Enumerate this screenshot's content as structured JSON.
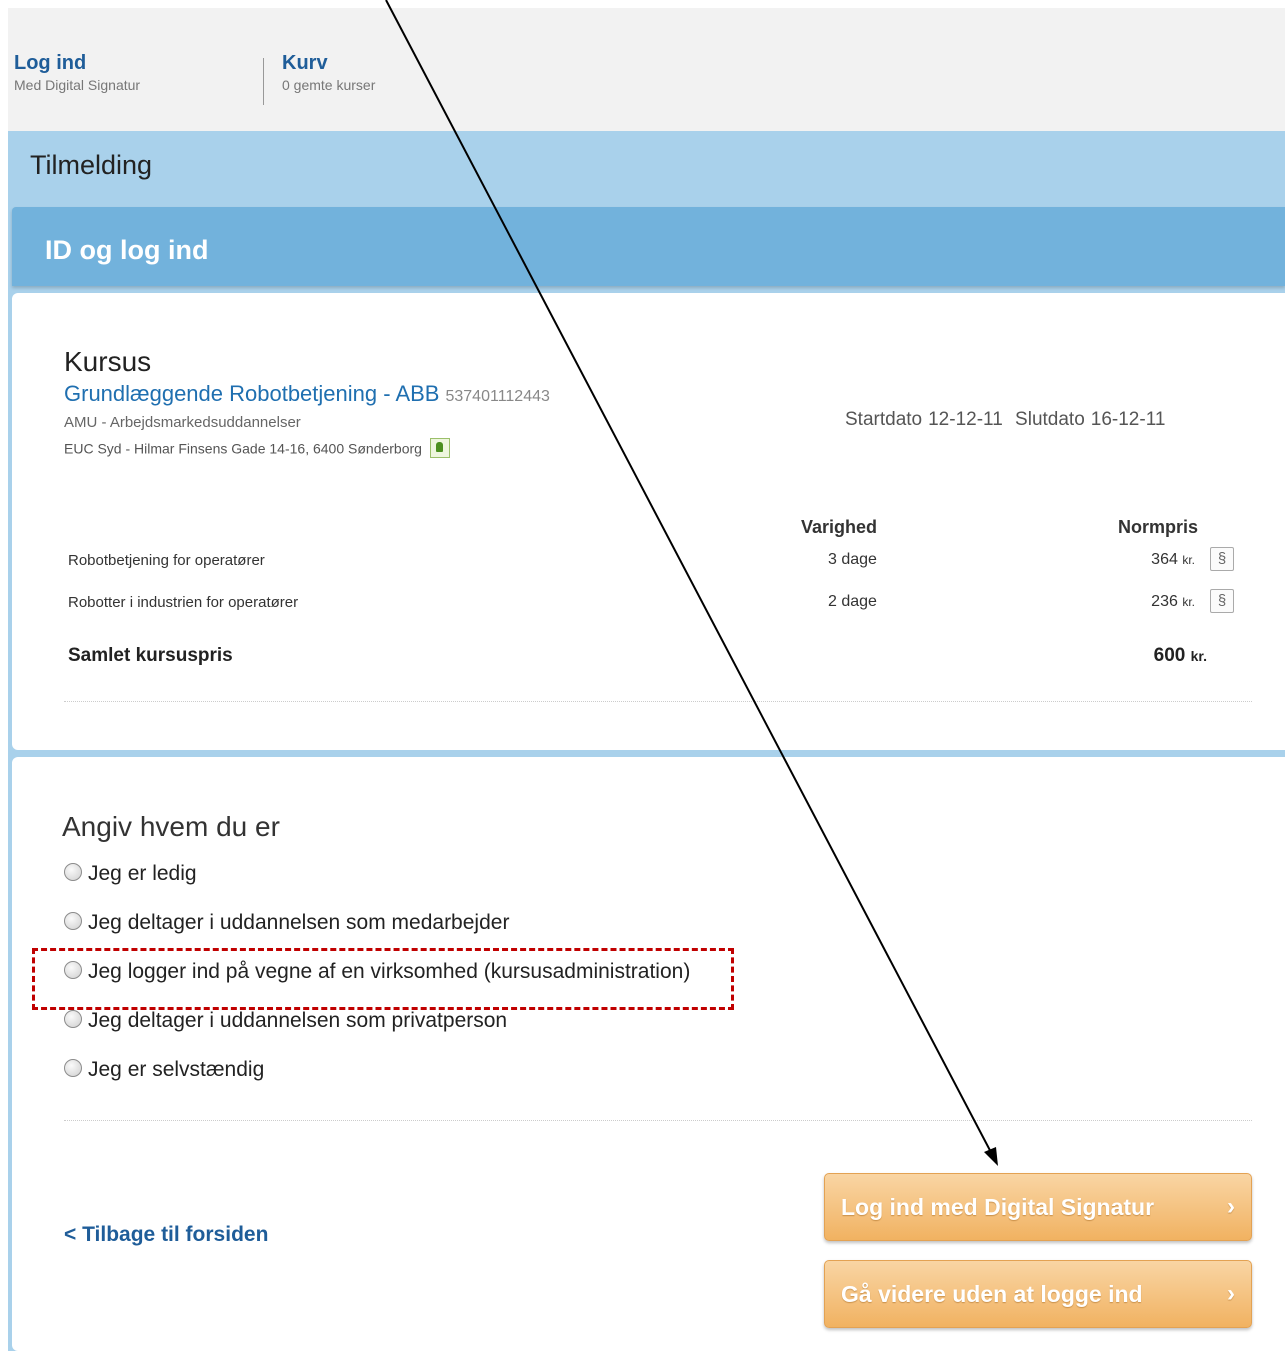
{
  "topbar": {
    "login": {
      "title": "Log ind",
      "subtitle": "Med Digital Signatur"
    },
    "basket": {
      "title": "Kurv",
      "subtitle": "0 gemte kurser"
    }
  },
  "page_title": "Tilmelding",
  "section_title": "ID og log ind",
  "course": {
    "heading": "Kursus",
    "name": "Grundlæggende Robotbetjening - ABB",
    "code": "537401112443",
    "type": "AMU - Arbejdsmarkedsuddannelser",
    "address": "EUC Syd - Hilmar Finsens Gade 14-16, 6400 Sønderborg",
    "start_label": "Startdato",
    "start_date": "12-12-11",
    "end_label": "Slutdato",
    "end_date": "16-12-11",
    "table": {
      "col_duration": "Varighed",
      "col_price": "Normpris",
      "rows": [
        {
          "label": "Robotbetjening for operatører",
          "duration": "3 dage",
          "price": "364",
          "unit": "kr.",
          "icon": "§"
        },
        {
          "label": "Robotter i industrien for operatører",
          "duration": "2 dage",
          "price": "236",
          "unit": "kr.",
          "icon": "§"
        }
      ],
      "total_label": "Samlet kursuspris",
      "total_value": "600",
      "total_unit": "kr."
    }
  },
  "identity": {
    "heading": "Angiv hvem du er",
    "options": [
      "Jeg er ledig",
      "Jeg deltager i uddannelsen som medarbejder",
      "Jeg logger ind på vegne af en virksomhed (kursusadministration)",
      "Jeg deltager i uddannelsen som privatperson",
      "Jeg er selvstændig"
    ],
    "highlighted_index": 2
  },
  "actions": {
    "back_link": "< Tilbage til forsiden",
    "login_button": "Log ind med Digital Signatur",
    "continue_button": "Gå videre uden at logge ind",
    "arrow_glyph": "›"
  },
  "colors": {
    "link_blue": "#1f5d99",
    "header_blue": "#72b2dc",
    "stripe_blue": "#a9d1eb",
    "button_orange": "#f1b261",
    "highlight_red": "#c00000"
  }
}
